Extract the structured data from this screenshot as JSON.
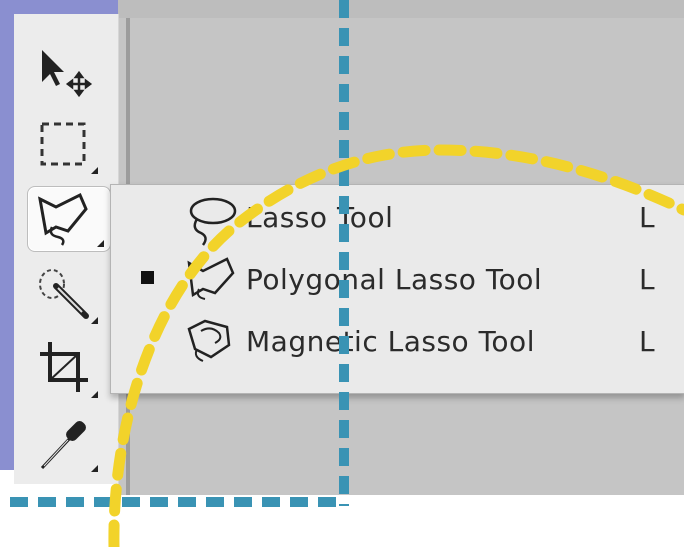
{
  "menu": {
    "items": [
      {
        "label": "Lasso Tool",
        "shortcut": "L",
        "selected": false,
        "icon": "lasso-icon"
      },
      {
        "label": "Polygonal Lasso Tool",
        "shortcut": "L",
        "selected": true,
        "icon": "polygonal-lasso-icon"
      },
      {
        "label": "Magnetic Lasso Tool",
        "shortcut": "L",
        "selected": false,
        "icon": "magnetic-lasso-icon"
      }
    ]
  },
  "toolbar": {
    "tools": [
      "move-tool",
      "marquee-tool",
      "polygonal-lasso-tool",
      "quick-selection-tool",
      "crop-tool",
      "eyedropper-tool"
    ],
    "active": "polygonal-lasso-tool"
  },
  "colors": {
    "annotation_yellow": "#f2d32a",
    "annotation_blue": "#3a93b4",
    "canvas_gray": "#c5c5c5",
    "side_purple": "#8a8fd0"
  }
}
